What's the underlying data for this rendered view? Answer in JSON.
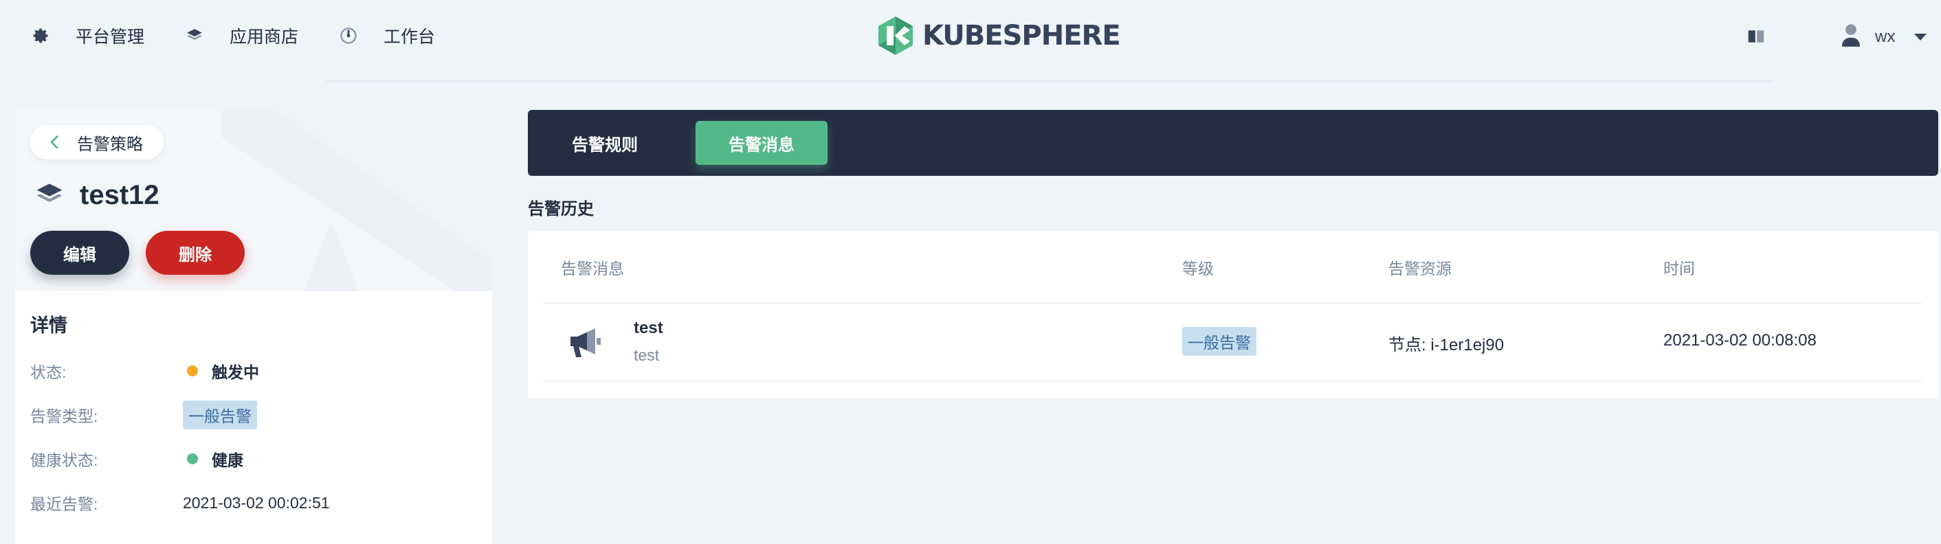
{
  "nav": {
    "platform_label": "平台管理",
    "store_label": "应用商店",
    "workbench_label": "工作台",
    "logo_text": "KUBESPHERE",
    "user_name": "wx"
  },
  "left": {
    "back_label": "告警策略",
    "policy_name": "test12",
    "edit_label": "编辑",
    "delete_label": "删除",
    "details_title": "详情",
    "details": {
      "status_label": "状态:",
      "status_value": "触发中",
      "status_color": "#f5a623",
      "type_label": "告警类型:",
      "type_value": "一般告警",
      "health_label": "健康状态:",
      "health_value": "健康",
      "health_color": "#55bc8a",
      "recent_label": "最近告警:",
      "recent_value": "2021-03-02 00:02:51"
    }
  },
  "tabs": {
    "rules_label": "告警规则",
    "messages_label": "告警消息",
    "active": "告警消息"
  },
  "history": {
    "title": "告警历史",
    "columns": {
      "message": "告警消息",
      "level": "等级",
      "resource": "告警资源",
      "time": "时间"
    },
    "rows": [
      {
        "name": "test",
        "subtitle": "test",
        "level": "一般告警",
        "resource": "节点: i-1er1ej90",
        "time": "2021-03-02 00:08:08"
      }
    ]
  },
  "colors": {
    "dark": "#242e42",
    "accent_green": "#55bc8a",
    "danger_red": "#ca2621",
    "tag_bg": "#c7deef",
    "tag_text": "#3a6c9d"
  },
  "icons": {
    "platform": "gear-icon",
    "store": "layers-icon",
    "workbench": "dashboard-icon",
    "doc": "book-icon",
    "user": "user-icon",
    "back": "chevron-left-icon",
    "policy": "stack-icon",
    "message": "megaphone-icon"
  }
}
